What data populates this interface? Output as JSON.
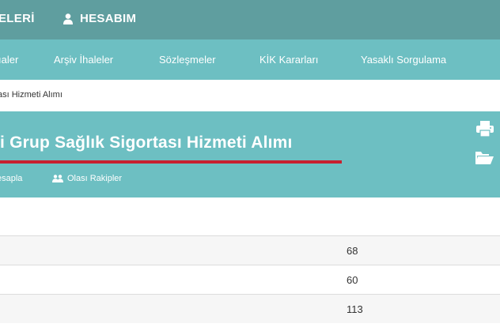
{
  "topbar": {
    "left_item": "ELERİ",
    "account_label": "HESABIM"
  },
  "nav": {
    "items": [
      {
        "label": "ıaler"
      },
      {
        "label": "Arşiv İhaleler"
      },
      {
        "label": "Sözleşmeler"
      },
      {
        "label": "KİK Kararları"
      },
      {
        "label": "Yasaklı Sorgulama"
      }
    ]
  },
  "breadcrumb": {
    "text": "ası Hizmeti Alımı"
  },
  "header": {
    "title": "ıi Grup Sağlık Sigortası Hizmeti Alımı",
    "actions": [
      {
        "label": "esapla"
      },
      {
        "label": "Olası Rakipler",
        "icon": "users-icon"
      }
    ],
    "side_icons": [
      "print-icon",
      "folder-open-icon"
    ]
  },
  "table": {
    "rows": [
      {
        "value": "68"
      },
      {
        "value": "60"
      },
      {
        "value": "113"
      }
    ]
  },
  "colors": {
    "topbar": "#5f9e9f",
    "accent": "#6dbfc2",
    "underline": "#c8202f"
  }
}
